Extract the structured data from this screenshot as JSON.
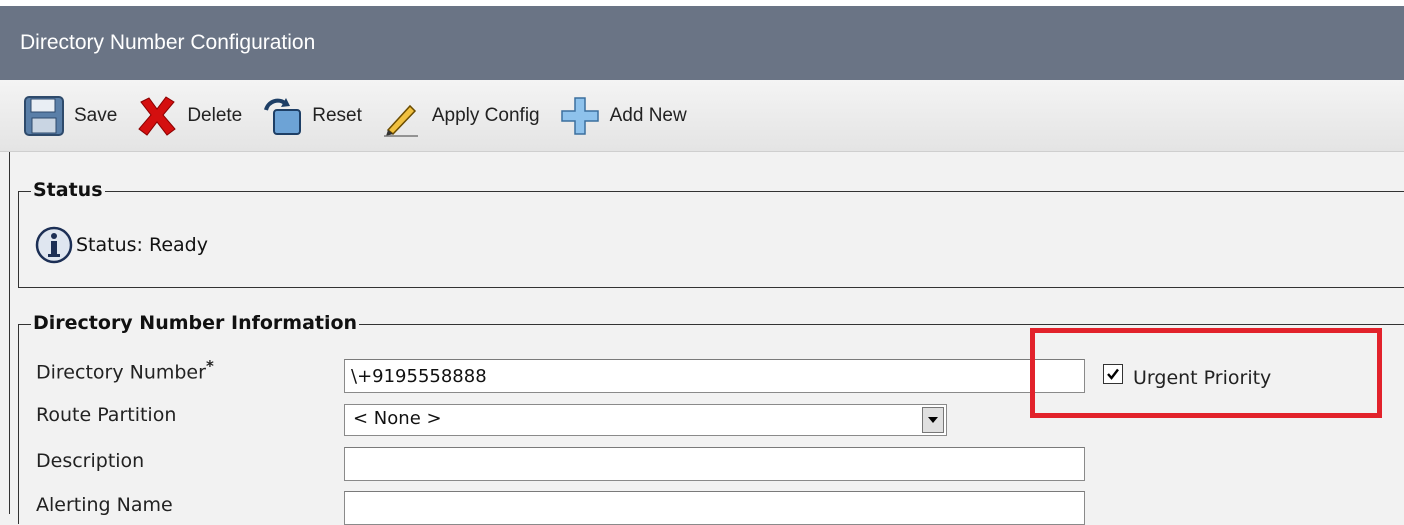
{
  "header": {
    "title": "Directory Number Configuration"
  },
  "toolbar": {
    "save_label": "Save",
    "delete_label": "Delete",
    "reset_label": "Reset",
    "apply_config_label": "Apply Config",
    "add_new_label": "Add New"
  },
  "status_section": {
    "legend": "Status",
    "text": "Status: Ready"
  },
  "dn_section": {
    "legend": "Directory Number Information",
    "directory_number": {
      "label": "Directory Number",
      "required_marker": "*",
      "value": "\\+9195558888"
    },
    "urgent_priority": {
      "label": "Urgent Priority",
      "checked": true
    },
    "route_partition": {
      "label": "Route Partition",
      "value": "< None >"
    },
    "description": {
      "label": "Description",
      "value": ""
    },
    "alerting_name": {
      "label": "Alerting Name",
      "value": ""
    }
  },
  "colors": {
    "title_bar": "#6a7485",
    "highlight": "#e2222b"
  }
}
